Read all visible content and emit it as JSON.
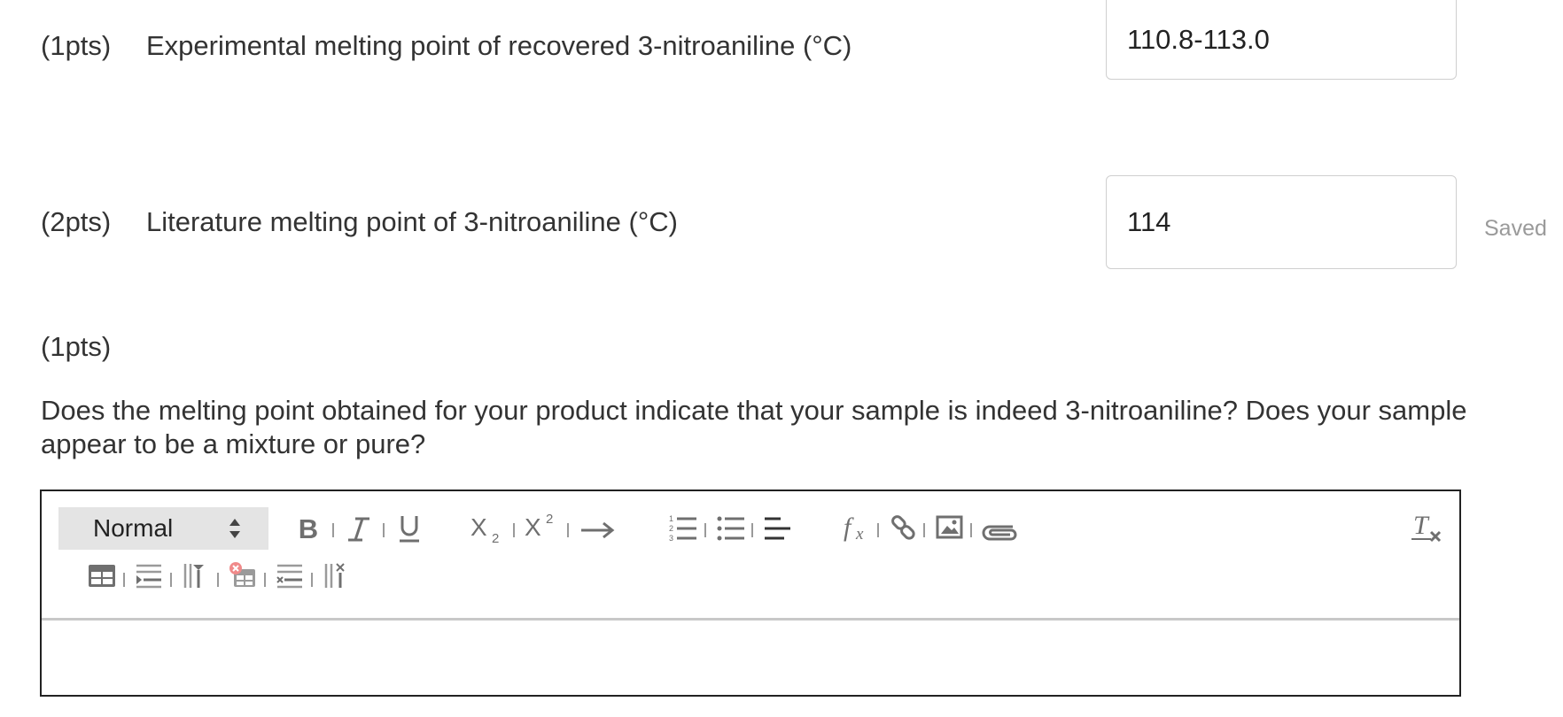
{
  "questions": [
    {
      "points": "(1pts)",
      "label": "Experimental melting point of recovered 3-nitroaniline (°C)",
      "value": "110.8-113.0"
    },
    {
      "points": "(2pts)",
      "label": "Literature melting point of 3-nitroaniline (°C)",
      "value": "114",
      "status": "Saved"
    },
    {
      "points": "(1pts)",
      "text": "Does the melting point obtained for your product indicate that your sample is indeed 3-nitroaniline? Does your sample appear to be a mixture or pure?"
    }
  ],
  "editor": {
    "format_select": "Normal",
    "icons": [
      "bold-icon",
      "italic-icon",
      "underline-icon",
      "subscript-icon",
      "superscript-icon",
      "arrow-icon",
      "ordered-list-icon",
      "bullet-list-icon",
      "align-icon",
      "formula-icon",
      "link-icon",
      "image-icon",
      "attachment-icon",
      "clear-format-icon",
      "table-icon",
      "insert-row-icon",
      "insert-column-icon",
      "delete-table-icon",
      "delete-row-icon",
      "delete-column-icon"
    ],
    "content": ""
  },
  "colors": {
    "icon": "#6f6f6f",
    "border": "#222222",
    "input_border": "#cfcfcf",
    "saved_text": "#9a9a9a",
    "select_bg": "#e4e4e4"
  }
}
